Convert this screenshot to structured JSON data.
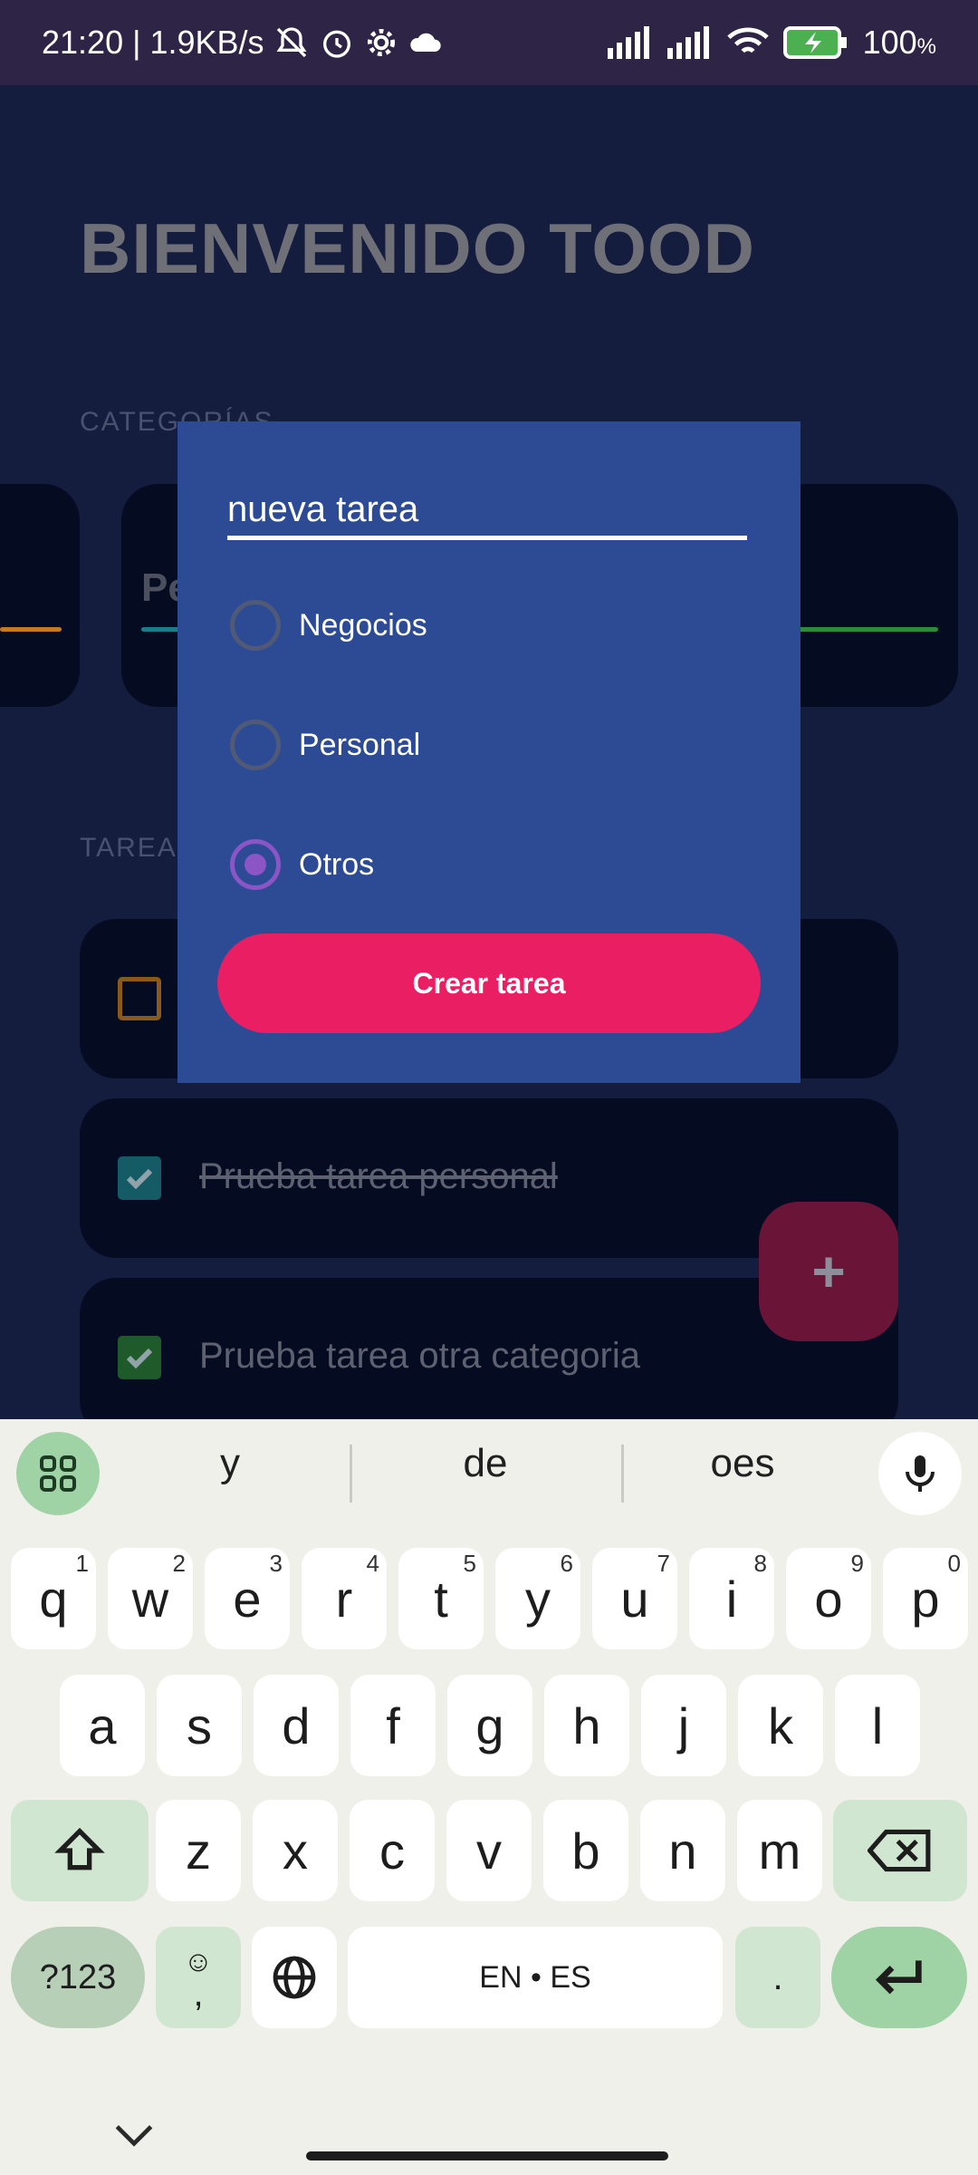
{
  "status_bar": {
    "time": "21:20",
    "network_speed": "| 1.9KB/s",
    "battery": "100",
    "battery_unit": "%",
    "icons": [
      "mute-bell-icon",
      "alarm-icon",
      "settings-gear-icon",
      "cloud-icon",
      "signal-icon",
      "signal-icon",
      "wifi-icon",
      "battery-charging-icon"
    ]
  },
  "app": {
    "welcome_title": "BIENVENIDO TOOD",
    "categories_label": "CATEGORÍAS",
    "category_cards": [
      {
        "name": "",
        "accent": "#c57a1d"
      },
      {
        "name": "Pe",
        "accent": "#1b7c8c"
      },
      {
        "name": "",
        "accent": "#2f8a3e"
      }
    ],
    "tasks_label": "TAREAS",
    "tasks": [
      {
        "label": "",
        "checked": false,
        "accent": "#c57a1d"
      },
      {
        "label": "Prueba tarea personal",
        "checked": true,
        "accent": "#1b8290"
      },
      {
        "label": "Prueba tarea otra categoria",
        "checked": true,
        "accent": "#2e8b3b"
      }
    ],
    "fab_label": "+"
  },
  "dialog": {
    "input_value": "nueva tarea",
    "options": [
      {
        "label": "Negocios",
        "selected": false
      },
      {
        "label": "Personal",
        "selected": false
      },
      {
        "label": "Otros",
        "selected": true
      }
    ],
    "create_button": "Crear tarea"
  },
  "keyboard": {
    "suggestions": [
      "y",
      "de",
      "oes"
    ],
    "row1": [
      {
        "k": "q",
        "n": "1"
      },
      {
        "k": "w",
        "n": "2"
      },
      {
        "k": "e",
        "n": "3"
      },
      {
        "k": "r",
        "n": "4"
      },
      {
        "k": "t",
        "n": "5"
      },
      {
        "k": "y",
        "n": "6"
      },
      {
        "k": "u",
        "n": "7"
      },
      {
        "k": "i",
        "n": "8"
      },
      {
        "k": "o",
        "n": "9"
      },
      {
        "k": "p",
        "n": "0"
      }
    ],
    "row2": [
      "a",
      "s",
      "d",
      "f",
      "g",
      "h",
      "j",
      "k",
      "l"
    ],
    "row3": [
      "z",
      "x",
      "c",
      "v",
      "b",
      "n",
      "m"
    ],
    "symbols_key": "?123",
    "comma_key": ",",
    "space_label": "EN • ES",
    "period_key": ".",
    "colors": {
      "accent": "#9fd2a4",
      "modifier": "#d1e6d1"
    }
  }
}
